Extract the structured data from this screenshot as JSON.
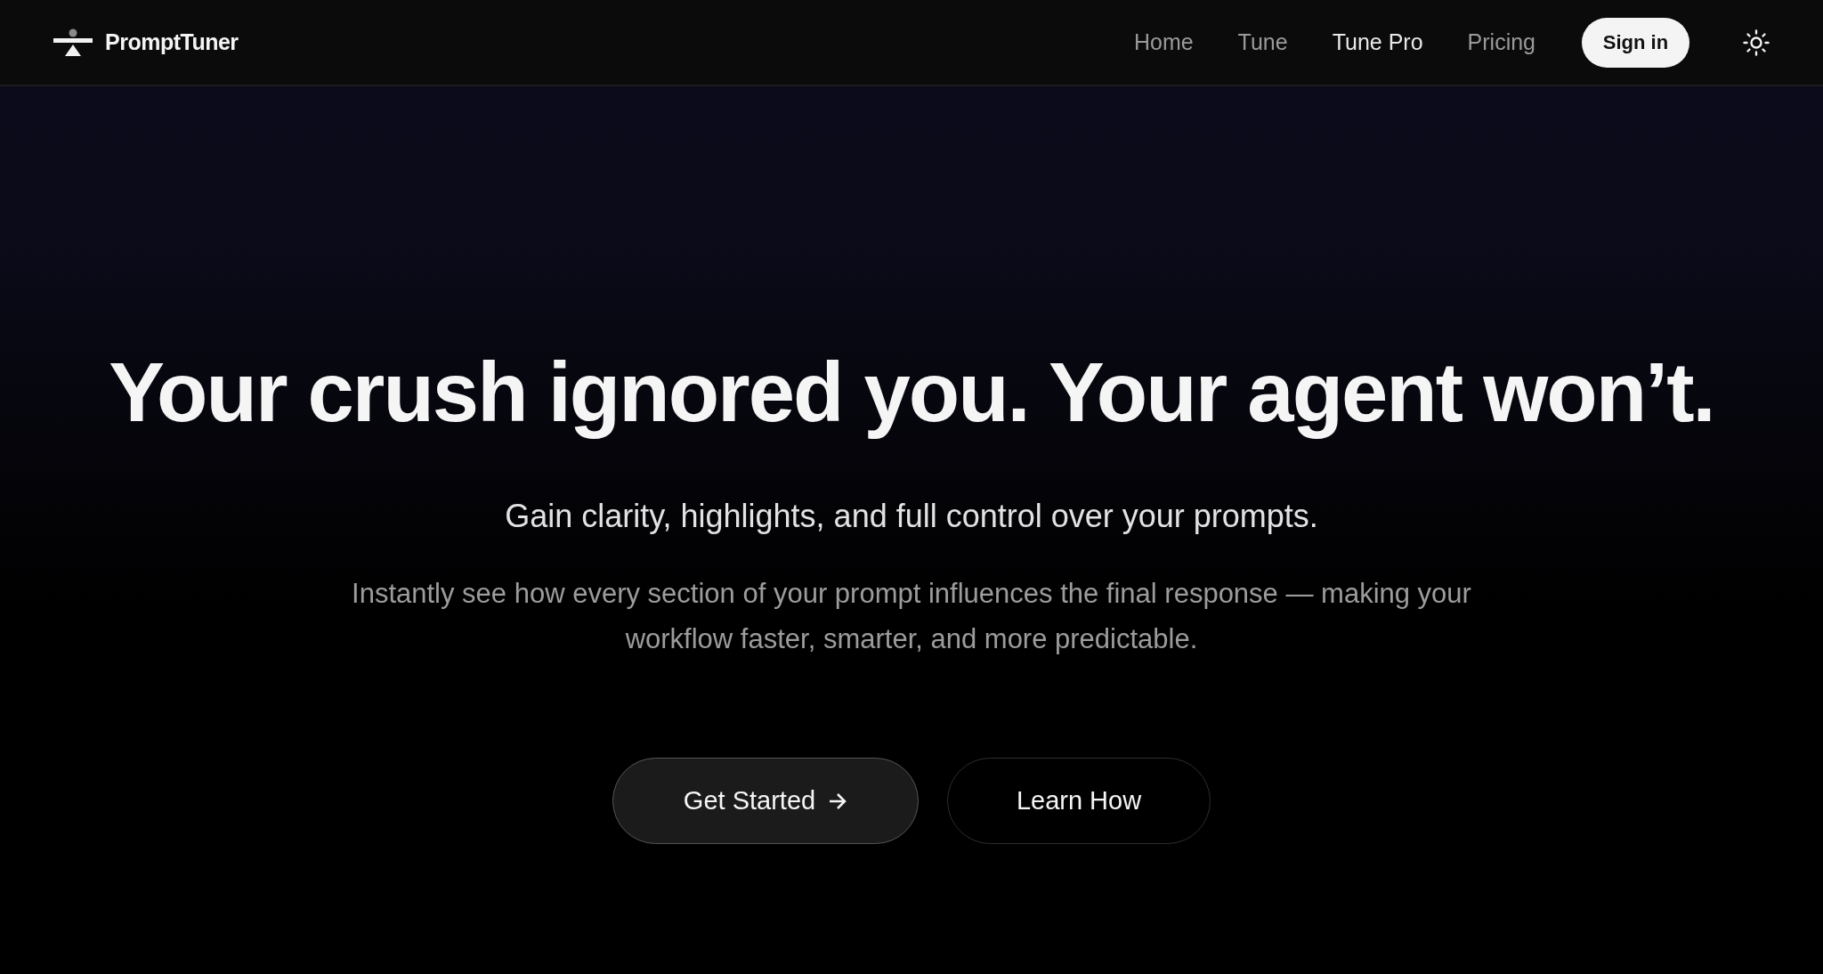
{
  "header": {
    "brand": "PromptTuner",
    "nav": [
      {
        "label": "Home",
        "selected": false
      },
      {
        "label": "Tune",
        "selected": false
      },
      {
        "label": "Tune Pro",
        "selected": true
      },
      {
        "label": "Pricing",
        "selected": false
      }
    ],
    "sign_in": "Sign in"
  },
  "hero": {
    "headline": "Your crush ignored you. Your agent won’t.",
    "subtitle": "Gain clarity, highlights, and full control over your prompts.",
    "description": "Instantly see how every section of your prompt influences the final response — making your workflow faster, smarter, and more predictable.",
    "buttons": [
      {
        "label": "Get Started",
        "kind": "primary"
      },
      {
        "label": "Learn How",
        "kind": "secondary"
      }
    ]
  }
}
